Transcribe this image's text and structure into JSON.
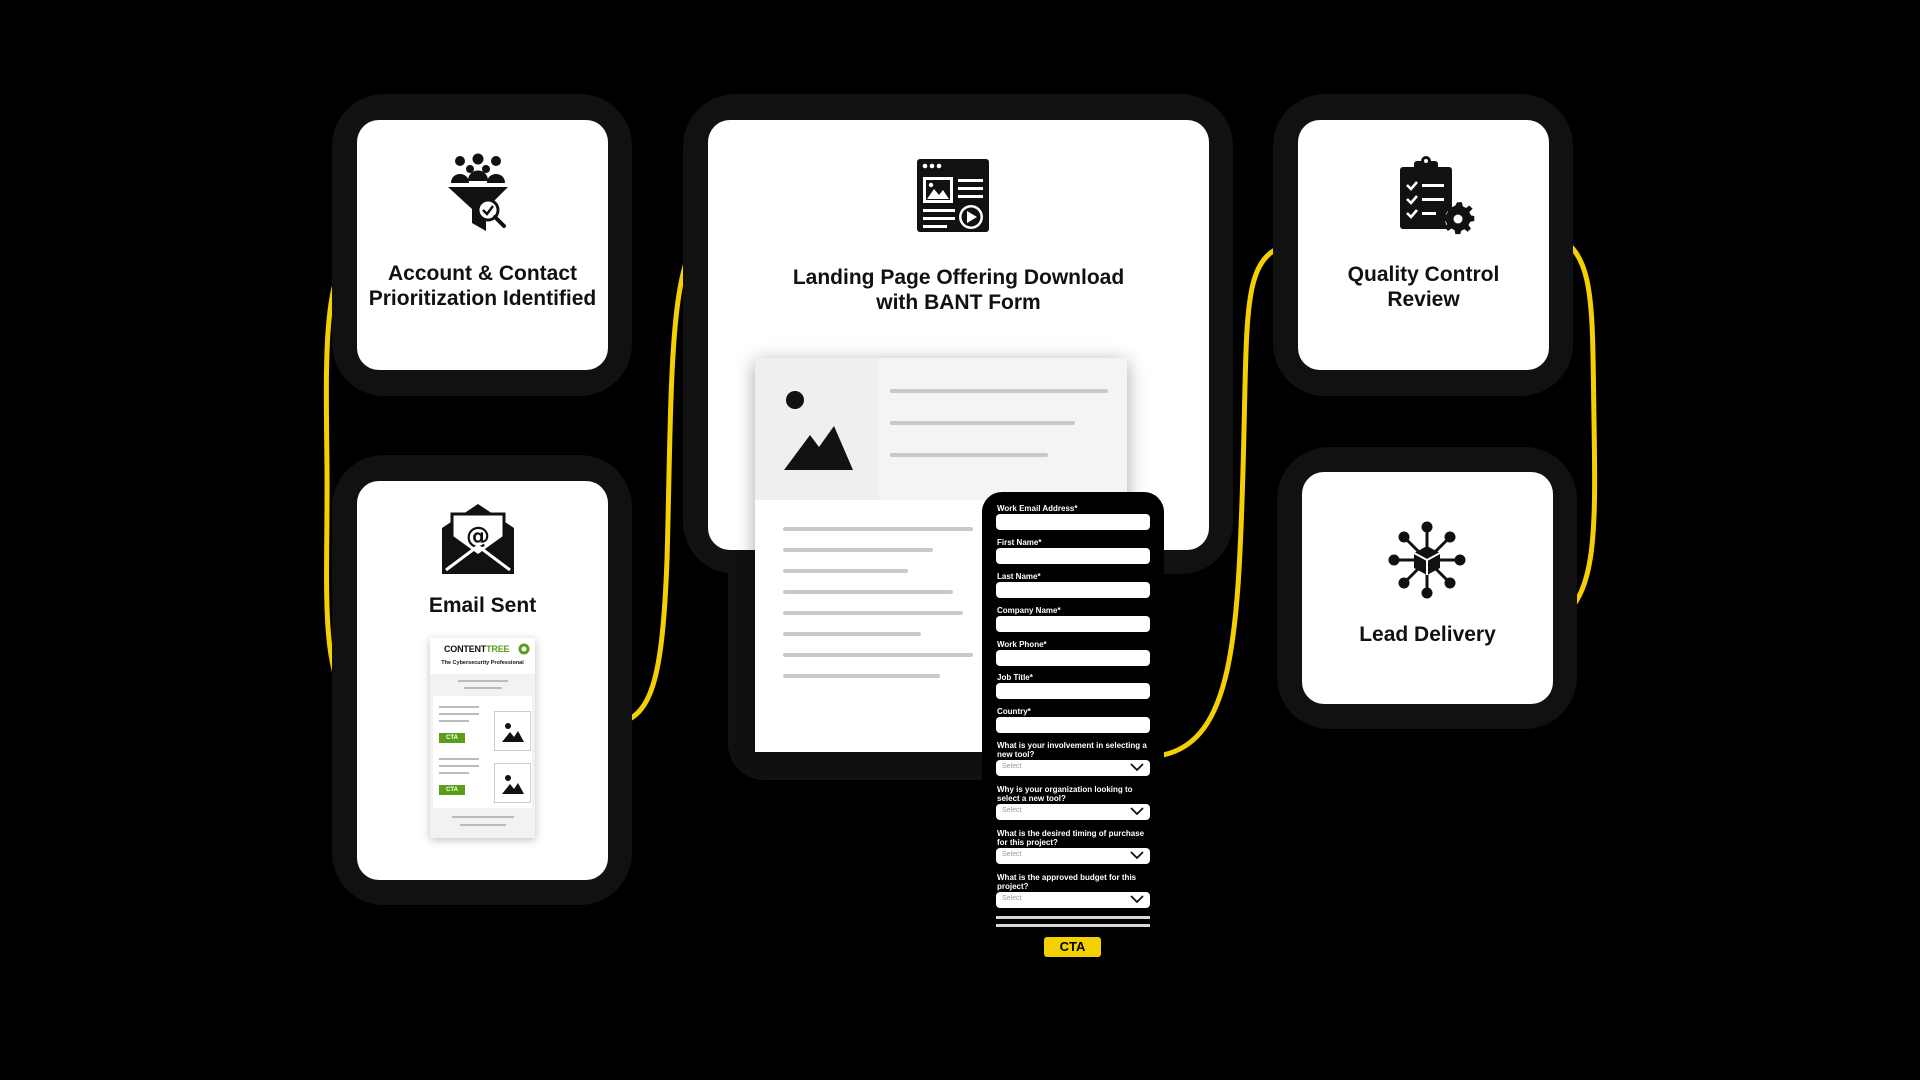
{
  "colors": {
    "background": "#000000",
    "frame": "#111111",
    "card": "#ffffff",
    "connector": "#f5d000",
    "cta": "#f5d000",
    "newsletter_cta": "#5a9e1a"
  },
  "steps": [
    {
      "title": "Account & Contact\nPrioritization Identified",
      "icon": "funnel-people-search-icon"
    },
    {
      "title": "Email Sent",
      "icon": "envelope-at-icon"
    },
    {
      "title": "Landing Page Offering Download\nwith BANT Form",
      "icon": "web-page-media-icon"
    },
    {
      "title": "Quality Control\nReview",
      "icon": "clipboard-checklist-gear-icon"
    },
    {
      "title": "Lead Delivery",
      "icon": "network-hub-icon"
    }
  ],
  "newsletter": {
    "brand_content": "CONTENT",
    "brand_tree": "TREE",
    "tagline": "The Cybersecurity Professional",
    "cta_labels": [
      "CTA",
      "CTA"
    ]
  },
  "form": {
    "fields": [
      "Work Email Address*",
      "First Name*",
      "Last Name*",
      "Company Name*",
      "Work Phone*",
      "Job Title*",
      "Country*"
    ],
    "selects": [
      {
        "question": "What is your involvement in selecting a new tool?",
        "placeholder": "Select"
      },
      {
        "question": "Why is your organization looking to select a new tool?",
        "placeholder": "Select"
      },
      {
        "question": "What is the desired timing of purchase for this project?",
        "placeholder": "Select"
      },
      {
        "question": "What is the approved budget for this project?",
        "placeholder": "Select"
      }
    ],
    "cta_label": "CTA"
  }
}
